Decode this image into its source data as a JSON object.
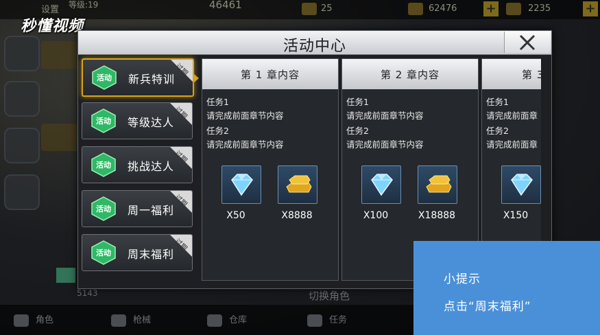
{
  "watermark": "秒懂视频",
  "background": {
    "settings_label": "设置",
    "level_text": "等级:19",
    "center_number": "46461",
    "currency_1": "25",
    "currency_2": "62476",
    "currency_3": "2235",
    "bottom_small": "5143",
    "bottom_center": "切换角色",
    "bottom_items": [
      "角色",
      "枪械",
      "仓库",
      "任务"
    ]
  },
  "dialog": {
    "title": "活动中心",
    "close_label": "close"
  },
  "sidebar": {
    "items": [
      {
        "badge": "活动",
        "label": "新兵特训",
        "ribbon": "过期",
        "active": true
      },
      {
        "badge": "活动",
        "label": "等级达人",
        "ribbon": "过期",
        "active": false
      },
      {
        "badge": "活动",
        "label": "挑战达人",
        "ribbon": "过期",
        "active": false
      },
      {
        "badge": "活动",
        "label": "周一福利",
        "ribbon": "过期",
        "active": false
      },
      {
        "badge": "活动",
        "label": "周末福利",
        "ribbon": "过期",
        "active": false
      }
    ]
  },
  "chapters": [
    {
      "title": "第 1 章内容",
      "tasks": [
        "任务1",
        "请完成前面章节内容",
        "任务2",
        "请完成前面章节内容"
      ],
      "rewards": [
        {
          "icon": "diamond-icon",
          "amount": "X50"
        },
        {
          "icon": "gold-bar-icon",
          "amount": "X8888"
        }
      ]
    },
    {
      "title": "第 2 章内容",
      "tasks": [
        "任务1",
        "请完成前面章节内容",
        "任务2",
        "请完成前面章节内容"
      ],
      "rewards": [
        {
          "icon": "diamond-icon",
          "amount": "X100"
        },
        {
          "icon": "gold-bar-icon",
          "amount": "X18888"
        }
      ]
    },
    {
      "title": "第 3",
      "tasks": [
        "任务1",
        "请完成前面章",
        "任务2",
        "请完成前面章"
      ],
      "rewards": [
        {
          "icon": "diamond-icon",
          "amount": "X150"
        }
      ]
    }
  ],
  "tip": {
    "title": "小提示",
    "text": "点击“周末福利”"
  },
  "colors": {
    "active_border": "#d7a31d",
    "badge_green": "#2fb865",
    "tip_blue": "#4a90d9"
  }
}
